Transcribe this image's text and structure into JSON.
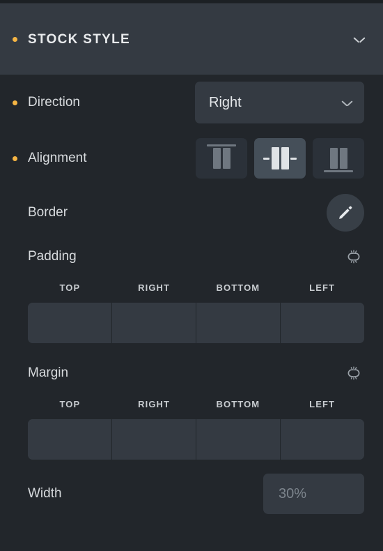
{
  "panel": {
    "header": {
      "title": "STOCK STYLE",
      "bullet_color": "#f5b544",
      "collapse_icon": "chevron-down-icon",
      "background": "#343a42"
    },
    "accent_color": "#f5b544",
    "background": "#22262b",
    "field_background": "#343a42",
    "selected_background": "#454f59"
  },
  "direction": {
    "label": "Direction",
    "value": "Right",
    "dropdown_icon": "chevron-down-icon"
  },
  "alignment": {
    "label": "Alignment",
    "options": [
      {
        "name": "align-top",
        "selected": false
      },
      {
        "name": "align-middle",
        "selected": true
      },
      {
        "name": "align-bottom",
        "selected": false
      }
    ]
  },
  "border": {
    "label": "Border",
    "edit_icon": "pencil-icon"
  },
  "padding": {
    "label": "Padding",
    "link_icon": "broken-link-icon",
    "fields": [
      {
        "label": "TOP",
        "value": ""
      },
      {
        "label": "RIGHT",
        "value": ""
      },
      {
        "label": "BOTTOM",
        "value": ""
      },
      {
        "label": "LEFT",
        "value": ""
      }
    ]
  },
  "margin": {
    "label": "Margin",
    "link_icon": "broken-link-icon",
    "fields": [
      {
        "label": "TOP",
        "value": ""
      },
      {
        "label": "RIGHT",
        "value": ""
      },
      {
        "label": "BOTTOM",
        "value": ""
      },
      {
        "label": "LEFT",
        "value": ""
      }
    ]
  },
  "width": {
    "label": "Width",
    "value": "",
    "placeholder": "30%"
  }
}
